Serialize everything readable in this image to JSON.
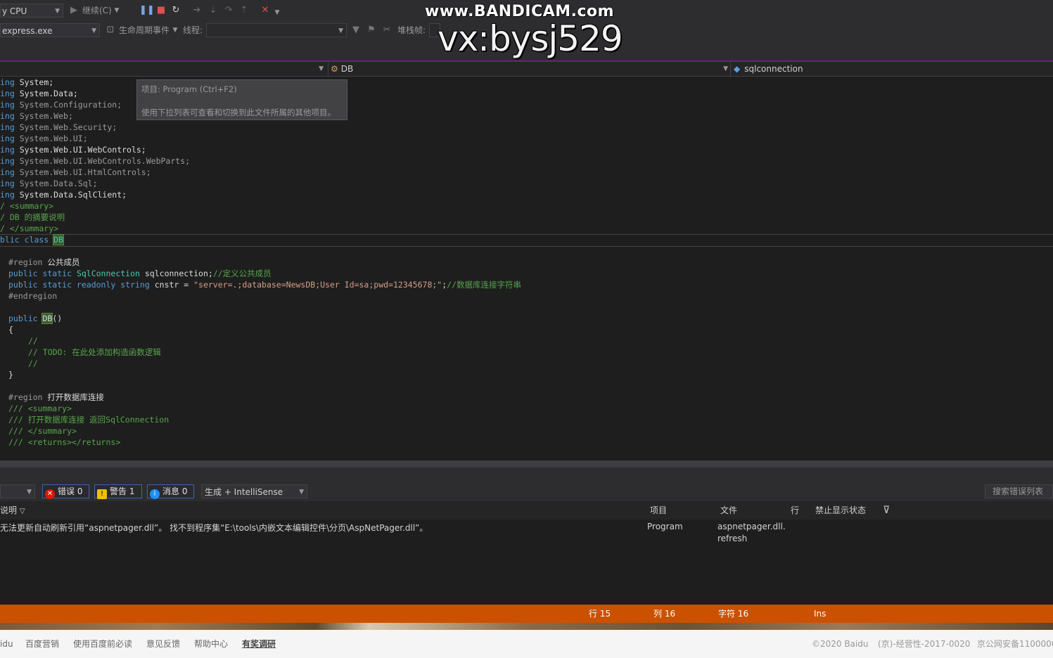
{
  "toolbar": {
    "cpu_combo": "y CPU",
    "continue_label": "继续(C)",
    "process_combo": "express.exe",
    "lifecycle_label": "生命周期事件",
    "thread_label": "线程:",
    "thread_value": "",
    "stackframe_label": "堆栈帧:"
  },
  "watermark": {
    "line1": "www.BANDICAM.com",
    "line2": "vx:bysj529"
  },
  "navbar": {
    "project_combo": "",
    "class_combo": "DB",
    "member_combo": "sqlconnection"
  },
  "tooltip": {
    "title": "项目: Program (Ctrl+F2)",
    "body": "使用下拉列表可查看和切换到此文件所属的其他项目。"
  },
  "code": {
    "using_prefix": "ing",
    "usings": [
      "System;",
      "System.Data;",
      "System.Configuration;",
      "System.Web;",
      "System.Web.Security;",
      "System.Web.UI;",
      "System.Web.UI.WebControls;",
      "System.Web.UI.WebControls.WebParts;",
      "System.Web.UI.HtmlControls;",
      "System.Data.Sql;",
      "System.Data.SqlClient;"
    ],
    "summary_open": "/ <summary>",
    "summary_text": "/ DB 的摘要说明",
    "summary_close": "/ </summary>",
    "class_decl_kw": "blic class ",
    "class_name": "DB",
    "region1_kw": "#region",
    "region1_name": "公共成员",
    "field1_kw": "public static ",
    "field1_type": "SqlConnection",
    "field1_name": " sqlconnection;",
    "field1_comment": "//定义公共成员",
    "field2_kw": "public static readonly string",
    "field2_name": " cnstr = ",
    "field2_str": "\"server=.;database=NewsDB;User Id=sa;pwd=12345678;\"",
    "field2_end": ";",
    "field2_comment": "//数据库连接字符串",
    "endregion": "#endregion",
    "ctor_kw": "public ",
    "ctor_name": "DB",
    "ctor_parens": "()",
    "brace_open": "{",
    "ctor_c1": "//",
    "ctor_c2": "// TODO: 在此处添加构造函数逻辑",
    "ctor_c3": "//",
    "brace_close": "}",
    "region2_kw": "#region",
    "region2_name": "打开数据库连接",
    "doc1": "/// <summary>",
    "doc2": "/// 打开数据库连接 返回SqlConnection",
    "doc3": "/// </summary>",
    "doc4": "/// <returns></returns>"
  },
  "error_list": {
    "scope_combo": "",
    "errors_label": "错误 0",
    "warnings_label": "警告 1",
    "messages_label": "消息 0",
    "build_combo": "生成 + IntelliSense",
    "search_placeholder": "搜索错误列表",
    "columns": {
      "description": "说明",
      "project": "项目",
      "file": "文件",
      "line": "行",
      "suppression": "禁止显示状态"
    },
    "rows": [
      {
        "description": "无法更新自动刷新引用“aspnetpager.dll”。 找不到程序集“E:\\tools\\内嵌文本编辑控件\\分页\\AspNetPager.dll”。",
        "project": "Program",
        "file_line1": "aspnetpager.dll.",
        "file_line2": "refresh"
      }
    ]
  },
  "status_bar": {
    "line": "行 15",
    "col": "列 16",
    "char": "字符 16",
    "mode": "Ins"
  },
  "footer": {
    "links": [
      "idu",
      "百度营销",
      "使用百度前必读",
      "意见反馈",
      "帮助中心",
      "有奖调研"
    ],
    "copyright": "©2020 Baidu",
    "license": "(京)-经营性-2017-0020",
    "icp": "京公网安备1100000"
  },
  "colors": {
    "status_bar": "#ca5100",
    "accent": "#68217a",
    "keyword": "#569cd6",
    "type": "#4ec9b0",
    "comment": "#57a64a",
    "string": "#d69d85"
  }
}
